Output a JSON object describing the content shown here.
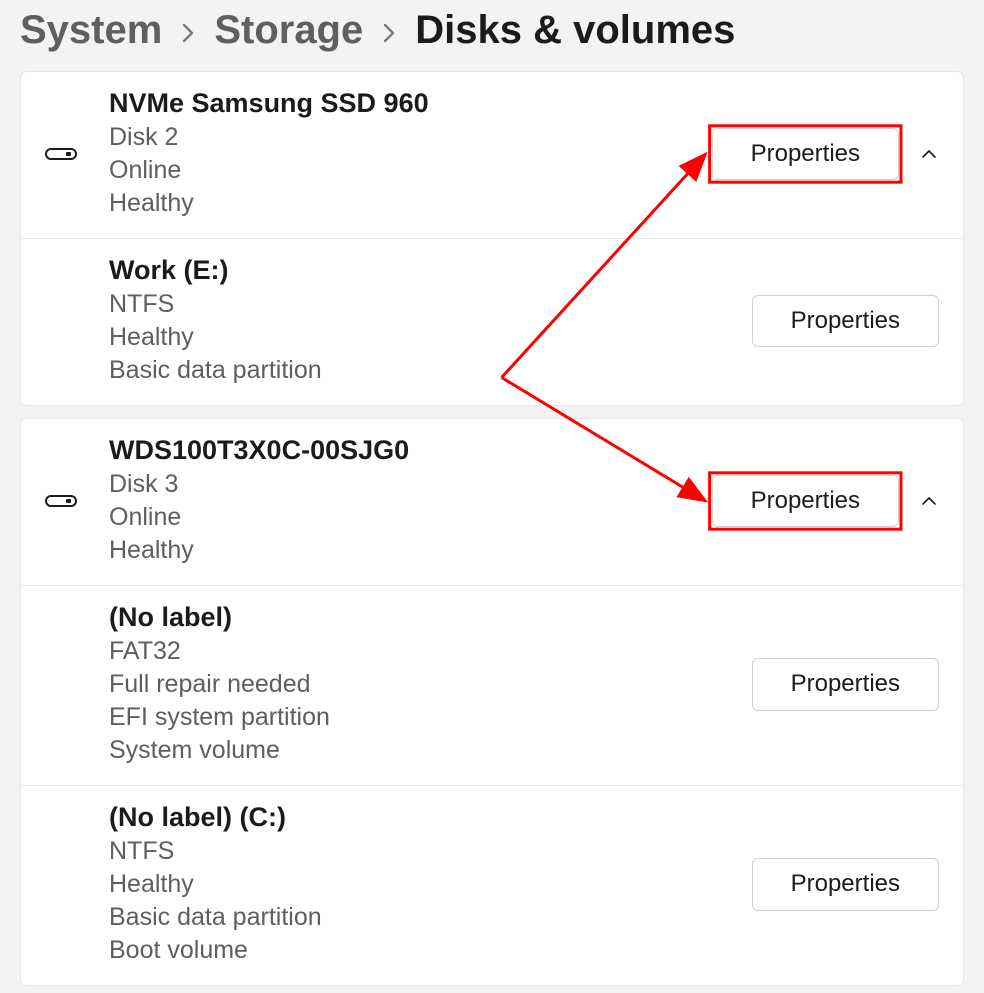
{
  "breadcrumb": {
    "system": "System",
    "storage": "Storage",
    "current": "Disks & volumes"
  },
  "common": {
    "properties_label": "Properties"
  },
  "groups": [
    {
      "disk": {
        "name": "NVMe Samsung SSD 960",
        "id": "Disk 2",
        "status": "Online",
        "health": "Healthy"
      },
      "volumes": [
        {
          "name": "Work (E:)",
          "fs": "NTFS",
          "health": "Healthy",
          "ptype": "Basic data partition",
          "role": ""
        }
      ]
    },
    {
      "disk": {
        "name": "WDS100T3X0C-00SJG0",
        "id": "Disk 3",
        "status": "Online",
        "health": "Healthy"
      },
      "volumes": [
        {
          "name": "(No label)",
          "fs": "FAT32",
          "health": "Full repair needed",
          "ptype": "EFI system partition",
          "role": "System volume"
        },
        {
          "name": "(No label) (C:)",
          "fs": "NTFS",
          "health": "Healthy",
          "ptype": "Basic data partition",
          "role": "Boot volume"
        }
      ]
    }
  ],
  "annotation": {
    "highlight_color": "#ff0000",
    "highlight_targets": [
      "disk0-properties",
      "disk1-properties"
    ]
  }
}
